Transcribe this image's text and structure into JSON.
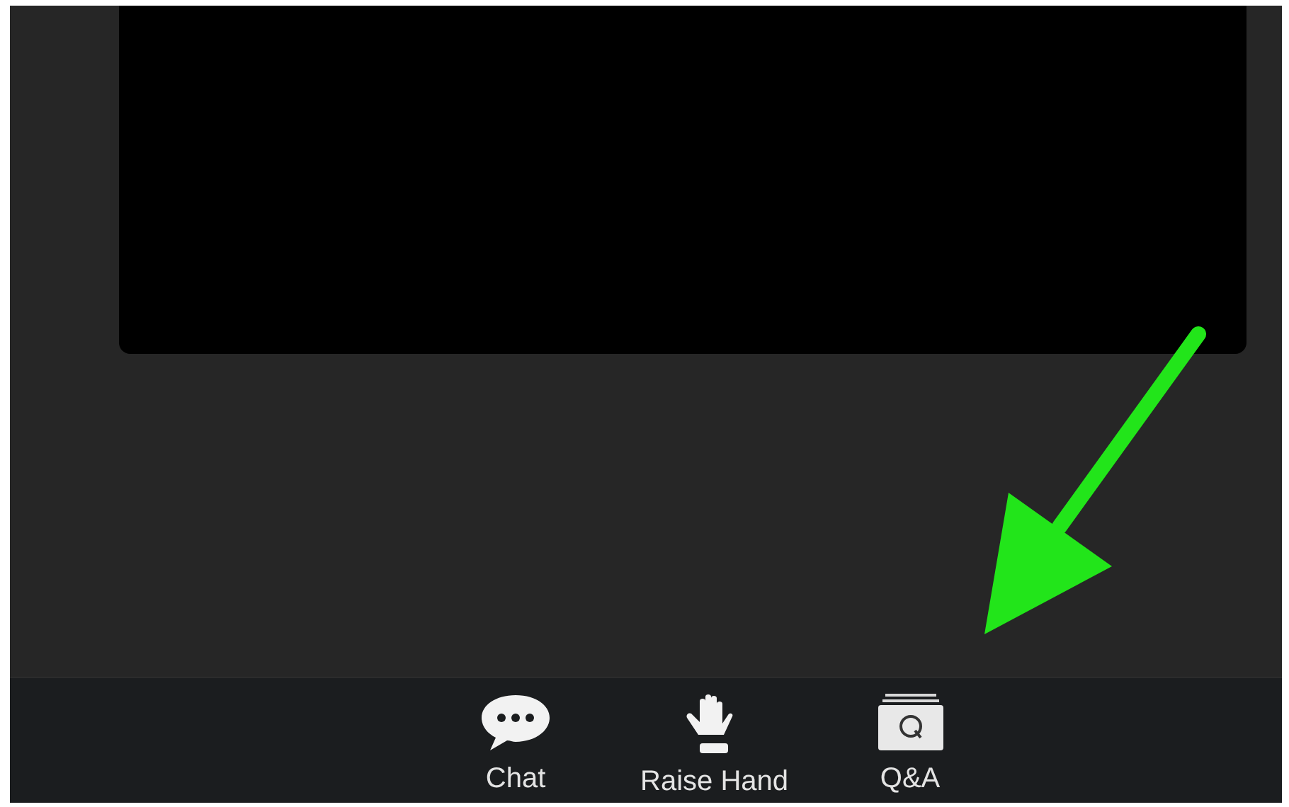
{
  "toolbar": {
    "buttons": [
      {
        "kind": "chat",
        "label": "Chat"
      },
      {
        "kind": "raise_hand",
        "label": "Raise Hand"
      },
      {
        "kind": "qa",
        "label": "Q&A"
      }
    ]
  }
}
